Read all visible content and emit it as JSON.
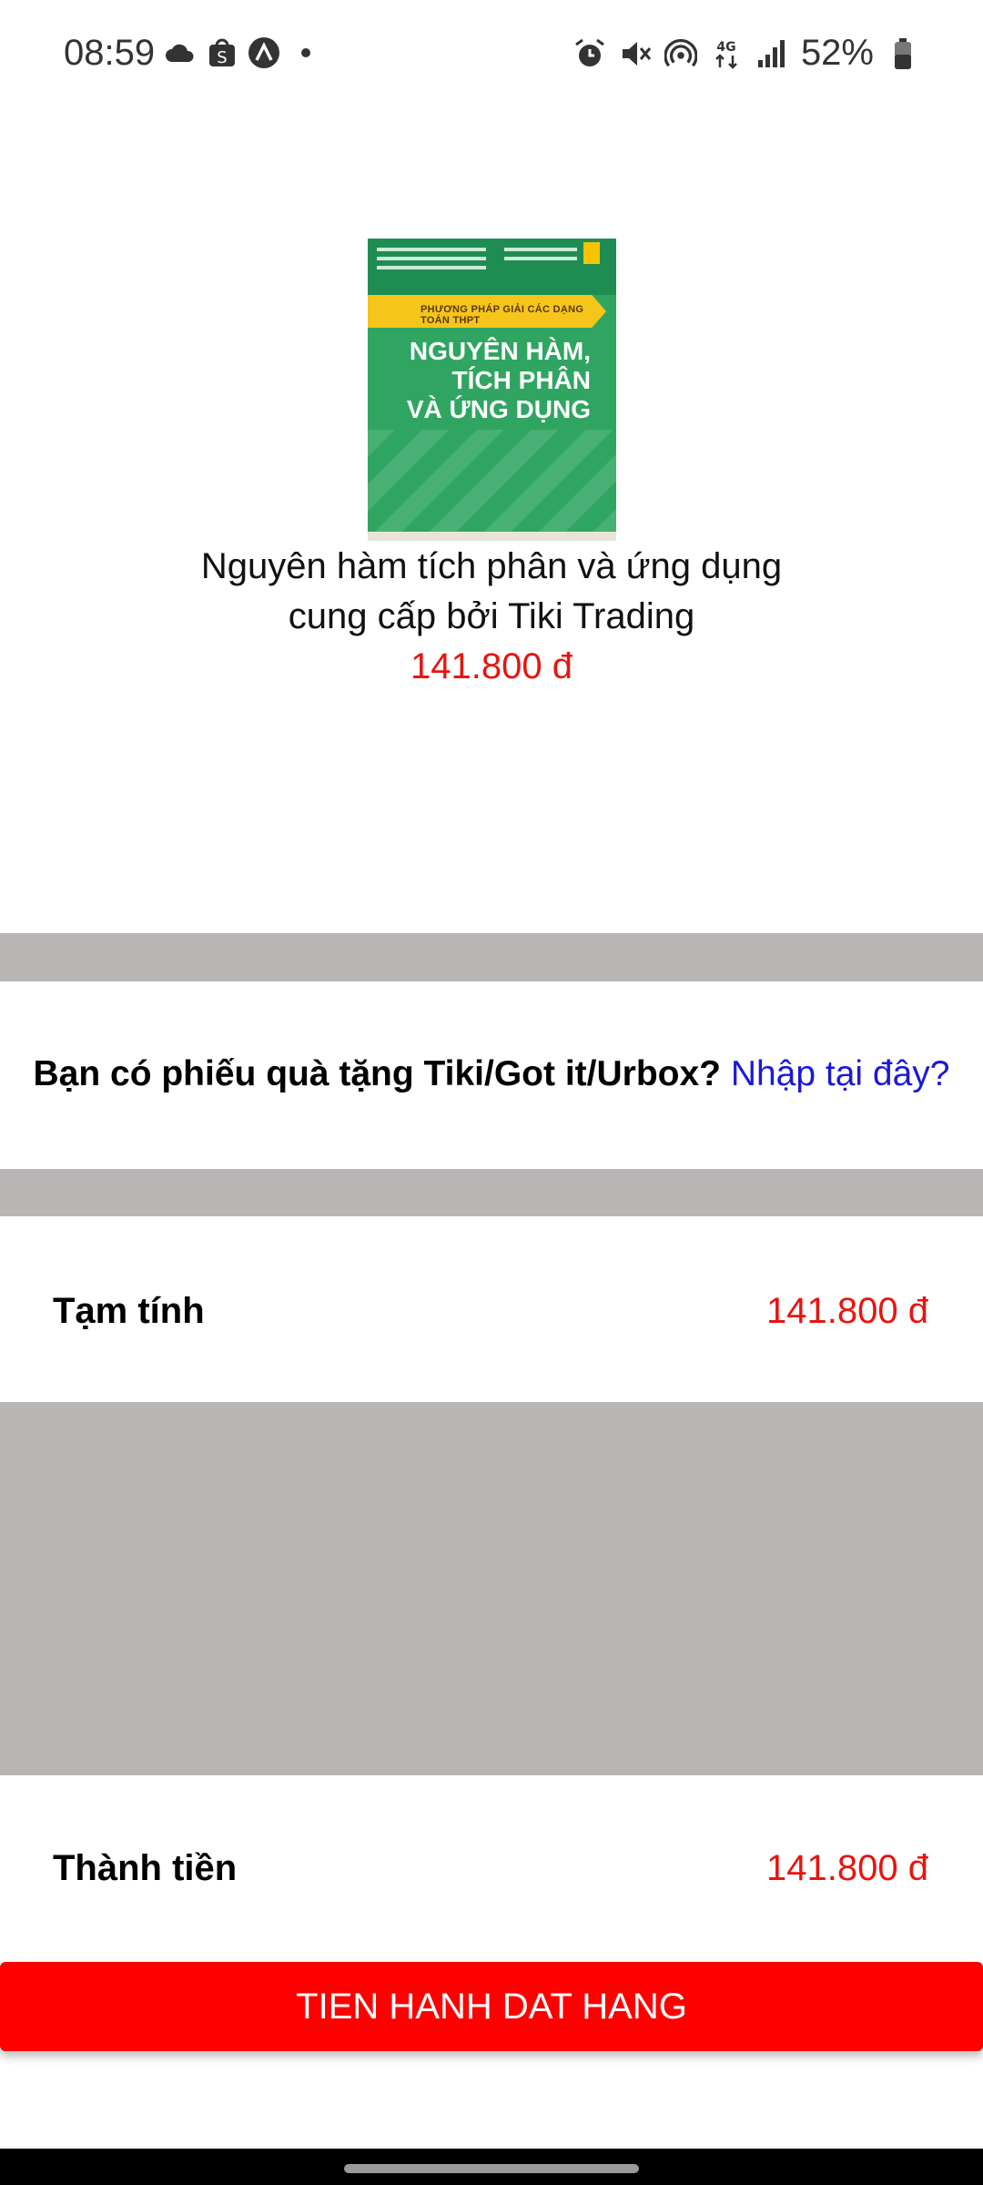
{
  "status_bar": {
    "time": "08:59",
    "battery": "52%",
    "icons_left": [
      "cloud-icon",
      "shopee-icon",
      "app-icon",
      "dot-icon"
    ],
    "icons_right": [
      "alarm-icon",
      "mute-icon",
      "hotspot-icon",
      "4g-icon",
      "signal-icon",
      "battery-icon"
    ],
    "network_label": "4G"
  },
  "product": {
    "name": "Nguyên hàm tích phân và ứng dụng",
    "seller": "cung cấp bởi Tiki Trading",
    "price": "141.800 đ",
    "cover": {
      "banner": "PHƯƠNG PHÁP GIẢI CÁC DẠNG TOÁN THPT",
      "title_line1": "NGUYÊN HÀM,",
      "title_line2": "TÍCH PHÂN",
      "title_line3": "VÀ ỨNG DỤNG",
      "color": "#2fa561"
    }
  },
  "voucher": {
    "question": "Bạn có phiếu quà tặng Tiki/Got it/Urbox?",
    "link": "Nhập tại đây?"
  },
  "subtotal": {
    "label": "Tạm tính",
    "value": "141.800 đ"
  },
  "total": {
    "label": "Thành tiền",
    "value": "141.800 đ"
  },
  "checkout_button": {
    "label": "TIEN HANH DAT HANG",
    "color": "#ff0000"
  },
  "colors": {
    "price": "#e8140f",
    "link": "#1a1ad6",
    "divider": "#bab5b5"
  }
}
